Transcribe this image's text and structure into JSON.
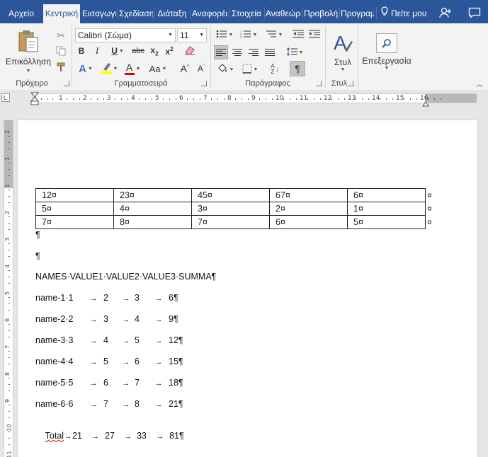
{
  "tabs": [
    {
      "id": "file",
      "label": "Αρχείο"
    },
    {
      "id": "home",
      "label": "Κεντρική",
      "active": true
    },
    {
      "id": "insert",
      "label": "Εισαγωγή"
    },
    {
      "id": "design",
      "label": "Σχεδίαση"
    },
    {
      "id": "layout",
      "label": "Διάταξη"
    },
    {
      "id": "references",
      "label": "Αναφορές"
    },
    {
      "id": "mailings",
      "label": "Στοιχεία"
    },
    {
      "id": "review",
      "label": "Αναθεώρηση"
    },
    {
      "id": "view",
      "label": "Προβολή"
    },
    {
      "id": "developer",
      "label": "Προγραμματιστής"
    }
  ],
  "tell_me": "Πείτε μου",
  "ribbon": {
    "paste_label": "Επικόλληση",
    "clipboard_label": "Πρόχειρο",
    "font_name": "Calibri (Σώμα)",
    "font_size": "11",
    "font_group_label": "Γραμματοσειρά",
    "paragraph_group_label": "Παράγραφος",
    "styles_button_label": "Στυλ",
    "styles_group_label": "Στυλ",
    "editing_label": "Επεξεργασία",
    "strikethrough_glyph": "abc",
    "change_case_glyph": "Aa"
  },
  "ruler_numbers": [
    "1",
    "2",
    "3",
    "4",
    "5",
    "6",
    "7",
    "8",
    "9",
    "10",
    "11",
    "12",
    "13",
    "14",
    "15",
    "16"
  ],
  "vruler_numbers": [
    "2",
    "1",
    "1",
    "2",
    "3",
    "4",
    "5",
    "6",
    "7",
    "8",
    "9",
    "10",
    "11"
  ],
  "document": {
    "table": [
      [
        "12¤",
        "23¤",
        "45¤",
        "67¤",
        "6¤"
      ],
      [
        "5¤",
        "4¤",
        "3¤",
        "2¤",
        "1¤"
      ],
      [
        "7¤",
        "8¤",
        "7¤",
        "6¤",
        "5¤"
      ]
    ],
    "row_end_mark": "¤",
    "empty_para_1": "¶",
    "empty_para_2": "¶",
    "header_line": "NAMES·VALUE1·VALUE2·VALUE3·SUMMA¶",
    "rows": [
      {
        "name": "name-1·1",
        "v1": "2",
        "v2": "3",
        "sum": "6¶"
      },
      {
        "name": "name-2·2",
        "v1": "3",
        "v2": "4",
        "sum": "9¶"
      },
      {
        "name": "name-3·3",
        "v1": "4",
        "v2": "5",
        "sum": "12¶"
      },
      {
        "name": "name-4·4",
        "v1": "5",
        "v2": "6",
        "sum": "15¶"
      },
      {
        "name": "name-5·5",
        "v1": "6",
        "v2": "7",
        "sum": "18¶"
      },
      {
        "name": "name-6·6",
        "v1": "7",
        "v2": "8",
        "sum": "21¶"
      }
    ],
    "total": {
      "name": "Total",
      "v0": "21",
      "v1": "27",
      "v2": "33",
      "sum": "81¶"
    },
    "tab_arrow": "→"
  },
  "colors": {
    "tabbar": "#2b579a",
    "ribbon": "#f3f3f3",
    "highlight": "#ffff00",
    "font_color": "#e00000"
  }
}
